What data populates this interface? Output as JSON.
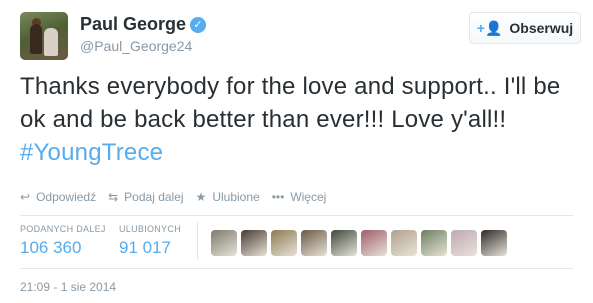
{
  "user": {
    "name": "Paul George",
    "handle": "@Paul_George24",
    "verified_icon": "✓"
  },
  "follow_button": {
    "icon": "+⁠👤",
    "label": "Obserwuj"
  },
  "tweet": {
    "text_main": "Thanks everybody for the love and support.. I'll be ok and be back better than ever!!! Love y'all!! ",
    "hashtag": "#YoungTrece"
  },
  "actions": [
    {
      "icon": "↩",
      "label": "Odpowiedź"
    },
    {
      "icon": "⇆",
      "label": "Podaj dalej"
    },
    {
      "icon": "★",
      "label": "Ulubione"
    },
    {
      "icon": "•••",
      "label": "Więcej"
    }
  ],
  "stats": {
    "retweets": {
      "label": "PODANYCH DALEJ",
      "value": "106 360"
    },
    "favorites": {
      "label": "ULUBIONYCH",
      "value": "91 017"
    }
  },
  "favoriters_colors": [
    "#7c7c6c",
    "#4a3a30",
    "#8c7a52",
    "#6a5a44",
    "#3d4a3a",
    "#a05c6a",
    "#b0a28c",
    "#6c8060",
    "#c0a8b4",
    "#2e2a2a"
  ],
  "timestamp": "21:09 - 1 sie 2014",
  "colors": {
    "accent": "#55acee",
    "text": "#292f33",
    "muted": "#8899a6"
  }
}
